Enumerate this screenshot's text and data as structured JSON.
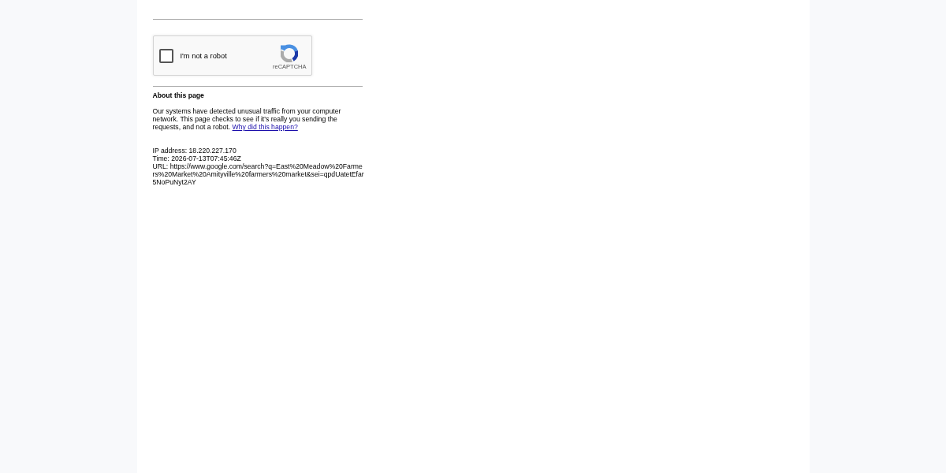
{
  "captcha": {
    "checked": false,
    "label": "I'm not a robot",
    "brand": "reCAPTCHA"
  },
  "about": {
    "heading": "About this page",
    "paragraph": "Our systems have detected unusual traffic from your computer network. This page checks to see if it's really you sending the requests, and not a robot.",
    "link": "Why did this happen?"
  },
  "details": {
    "ip": "IP address: 18.220.227.170",
    "time": "Time: 2026-07-13T07:45:46Z",
    "url": "URL: https://www.google.com/search?q=East%20Meadow%20Farmers%20Market%20Amityville%20farmers%20market&sei=qpdUatetEfar5NoPuNyt2AY"
  }
}
